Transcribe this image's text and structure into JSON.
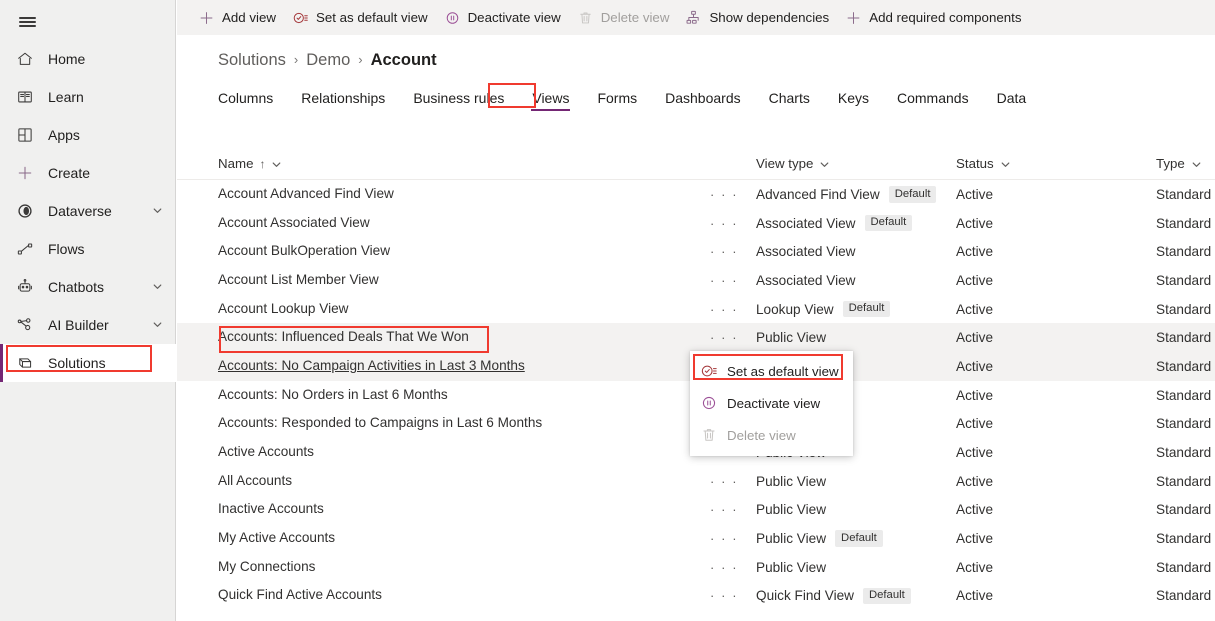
{
  "theme": {
    "accent": "#742774",
    "highlight_box": "#f03a2f",
    "sidebar_bg": "#f0f0ef",
    "cmdbar_bg": "#f3f2f1",
    "row_highlight": "#f3f2f1",
    "badge_bg": "#ebebeb",
    "disabled_text": "#a19f9d"
  },
  "sidebar": {
    "menu_icon": "hamburger-icon",
    "items": [
      {
        "label": "Home",
        "icon": "home-icon",
        "chevron": false,
        "active": false
      },
      {
        "label": "Learn",
        "icon": "book-icon",
        "chevron": false,
        "active": false
      },
      {
        "label": "Apps",
        "icon": "apps-grid-icon",
        "chevron": false,
        "active": false
      },
      {
        "label": "Create",
        "icon": "plus-icon",
        "chevron": false,
        "active": false
      },
      {
        "label": "Dataverse",
        "icon": "dataverse-icon",
        "chevron": true,
        "active": false
      },
      {
        "label": "Flows",
        "icon": "flows-icon",
        "chevron": false,
        "active": false
      },
      {
        "label": "Chatbots",
        "icon": "chatbot-icon",
        "chevron": true,
        "active": false
      },
      {
        "label": "AI Builder",
        "icon": "ai-builder-icon",
        "chevron": true,
        "active": false
      },
      {
        "label": "Solutions",
        "icon": "solutions-icon",
        "chevron": false,
        "active": true
      }
    ]
  },
  "commandbar": {
    "commands": [
      {
        "label": "Add view",
        "icon": "plus-icon",
        "disabled": false
      },
      {
        "label": "Set as default view",
        "icon": "set-default-icon",
        "disabled": false
      },
      {
        "label": "Deactivate view",
        "icon": "pause-circle-icon",
        "disabled": false
      },
      {
        "label": "Delete view",
        "icon": "trash-icon",
        "disabled": true
      },
      {
        "label": "Show dependencies",
        "icon": "dependencies-icon",
        "disabled": false
      },
      {
        "label": "Add required components",
        "icon": "plus-icon",
        "disabled": false
      }
    ]
  },
  "breadcrumb": {
    "items": [
      {
        "label": "Solutions",
        "current": false
      },
      {
        "label": "Demo",
        "current": false
      },
      {
        "label": "Account",
        "current": true
      }
    ],
    "separator": "›"
  },
  "tabs": {
    "items": [
      {
        "label": "Columns",
        "selected": false
      },
      {
        "label": "Relationships",
        "selected": false
      },
      {
        "label": "Business rules",
        "selected": false
      },
      {
        "label": "Views",
        "selected": true
      },
      {
        "label": "Forms",
        "selected": false
      },
      {
        "label": "Dashboards",
        "selected": false
      },
      {
        "label": "Charts",
        "selected": false
      },
      {
        "label": "Keys",
        "selected": false
      },
      {
        "label": "Commands",
        "selected": false
      },
      {
        "label": "Data",
        "selected": false
      }
    ]
  },
  "grid": {
    "columns": [
      {
        "label": "Name",
        "sorted": true,
        "sort_arrow": "↑"
      },
      {
        "label": "View type",
        "sorted": false,
        "sort_arrow": ""
      },
      {
        "label": "Status",
        "sorted": false,
        "sort_arrow": ""
      },
      {
        "label": "Type",
        "sorted": false,
        "sort_arrow": ""
      }
    ],
    "overflow_glyph": "· · ·",
    "rows": [
      {
        "name": "Account Advanced Find View",
        "view_type": "Advanced Find View",
        "default": true,
        "status": "Active",
        "type": "Standard",
        "highlighted": false,
        "underline": false,
        "show_dots": true
      },
      {
        "name": "Account Associated View",
        "view_type": "Associated View",
        "default": true,
        "status": "Active",
        "type": "Standard",
        "highlighted": false,
        "underline": false,
        "show_dots": true
      },
      {
        "name": "Account BulkOperation View",
        "view_type": "Associated View",
        "default": false,
        "status": "Active",
        "type": "Standard",
        "highlighted": false,
        "underline": false,
        "show_dots": true
      },
      {
        "name": "Account List Member View",
        "view_type": "Associated View",
        "default": false,
        "status": "Active",
        "type": "Standard",
        "highlighted": false,
        "underline": false,
        "show_dots": true
      },
      {
        "name": "Account Lookup View",
        "view_type": "Lookup View",
        "default": true,
        "status": "Active",
        "type": "Standard",
        "highlighted": false,
        "underline": false,
        "show_dots": true
      },
      {
        "name": "Accounts: Influenced Deals That We Won",
        "view_type": "Public View",
        "default": false,
        "status": "Active",
        "type": "Standard",
        "highlighted": true,
        "underline": false,
        "show_dots": true
      },
      {
        "name": "Accounts: No Campaign Activities in Last 3 Months",
        "view_type": "",
        "default": false,
        "status": "Active",
        "type": "Standard",
        "highlighted": true,
        "underline": true,
        "show_dots": false
      },
      {
        "name": "Accounts: No Orders in Last 6 Months",
        "view_type": "",
        "default": false,
        "status": "Active",
        "type": "Standard",
        "highlighted": false,
        "underline": false,
        "show_dots": false
      },
      {
        "name": "Accounts: Responded to Campaigns in Last 6 Months",
        "view_type": "",
        "default": false,
        "status": "Active",
        "type": "Standard",
        "highlighted": false,
        "underline": false,
        "show_dots": false
      },
      {
        "name": "Active Accounts",
        "view_type": "Public View",
        "default": false,
        "status": "Active",
        "type": "Standard",
        "highlighted": false,
        "underline": false,
        "show_dots": true
      },
      {
        "name": "All Accounts",
        "view_type": "Public View",
        "default": false,
        "status": "Active",
        "type": "Standard",
        "highlighted": false,
        "underline": false,
        "show_dots": true
      },
      {
        "name": "Inactive Accounts",
        "view_type": "Public View",
        "default": false,
        "status": "Active",
        "type": "Standard",
        "highlighted": false,
        "underline": false,
        "show_dots": true
      },
      {
        "name": "My Active Accounts",
        "view_type": "Public View",
        "default": true,
        "status": "Active",
        "type": "Standard",
        "highlighted": false,
        "underline": false,
        "show_dots": true
      },
      {
        "name": "My Connections",
        "view_type": "Public View",
        "default": false,
        "status": "Active",
        "type": "Standard",
        "highlighted": false,
        "underline": false,
        "show_dots": true
      },
      {
        "name": "Quick Find Active Accounts",
        "view_type": "Quick Find View",
        "default": true,
        "status": "Active",
        "type": "Standard",
        "highlighted": false,
        "underline": false,
        "show_dots": true
      }
    ],
    "default_badge_label": "Default"
  },
  "context_menu": {
    "items": [
      {
        "label": "Set as default view",
        "icon": "set-default-icon",
        "disabled": false,
        "highlighted": true
      },
      {
        "label": "Deactivate view",
        "icon": "pause-circle-icon",
        "disabled": false,
        "highlighted": false
      },
      {
        "label": "Delete view",
        "icon": "trash-icon",
        "disabled": true,
        "highlighted": false
      }
    ]
  },
  "annotations": {
    "boxes": [
      {
        "target": "sidebar-item-solutions"
      },
      {
        "target": "tab-views"
      },
      {
        "target": "row-accounts-influenced-deals-that-we-won"
      },
      {
        "target": "menu-item-set-as-default-view"
      }
    ]
  }
}
